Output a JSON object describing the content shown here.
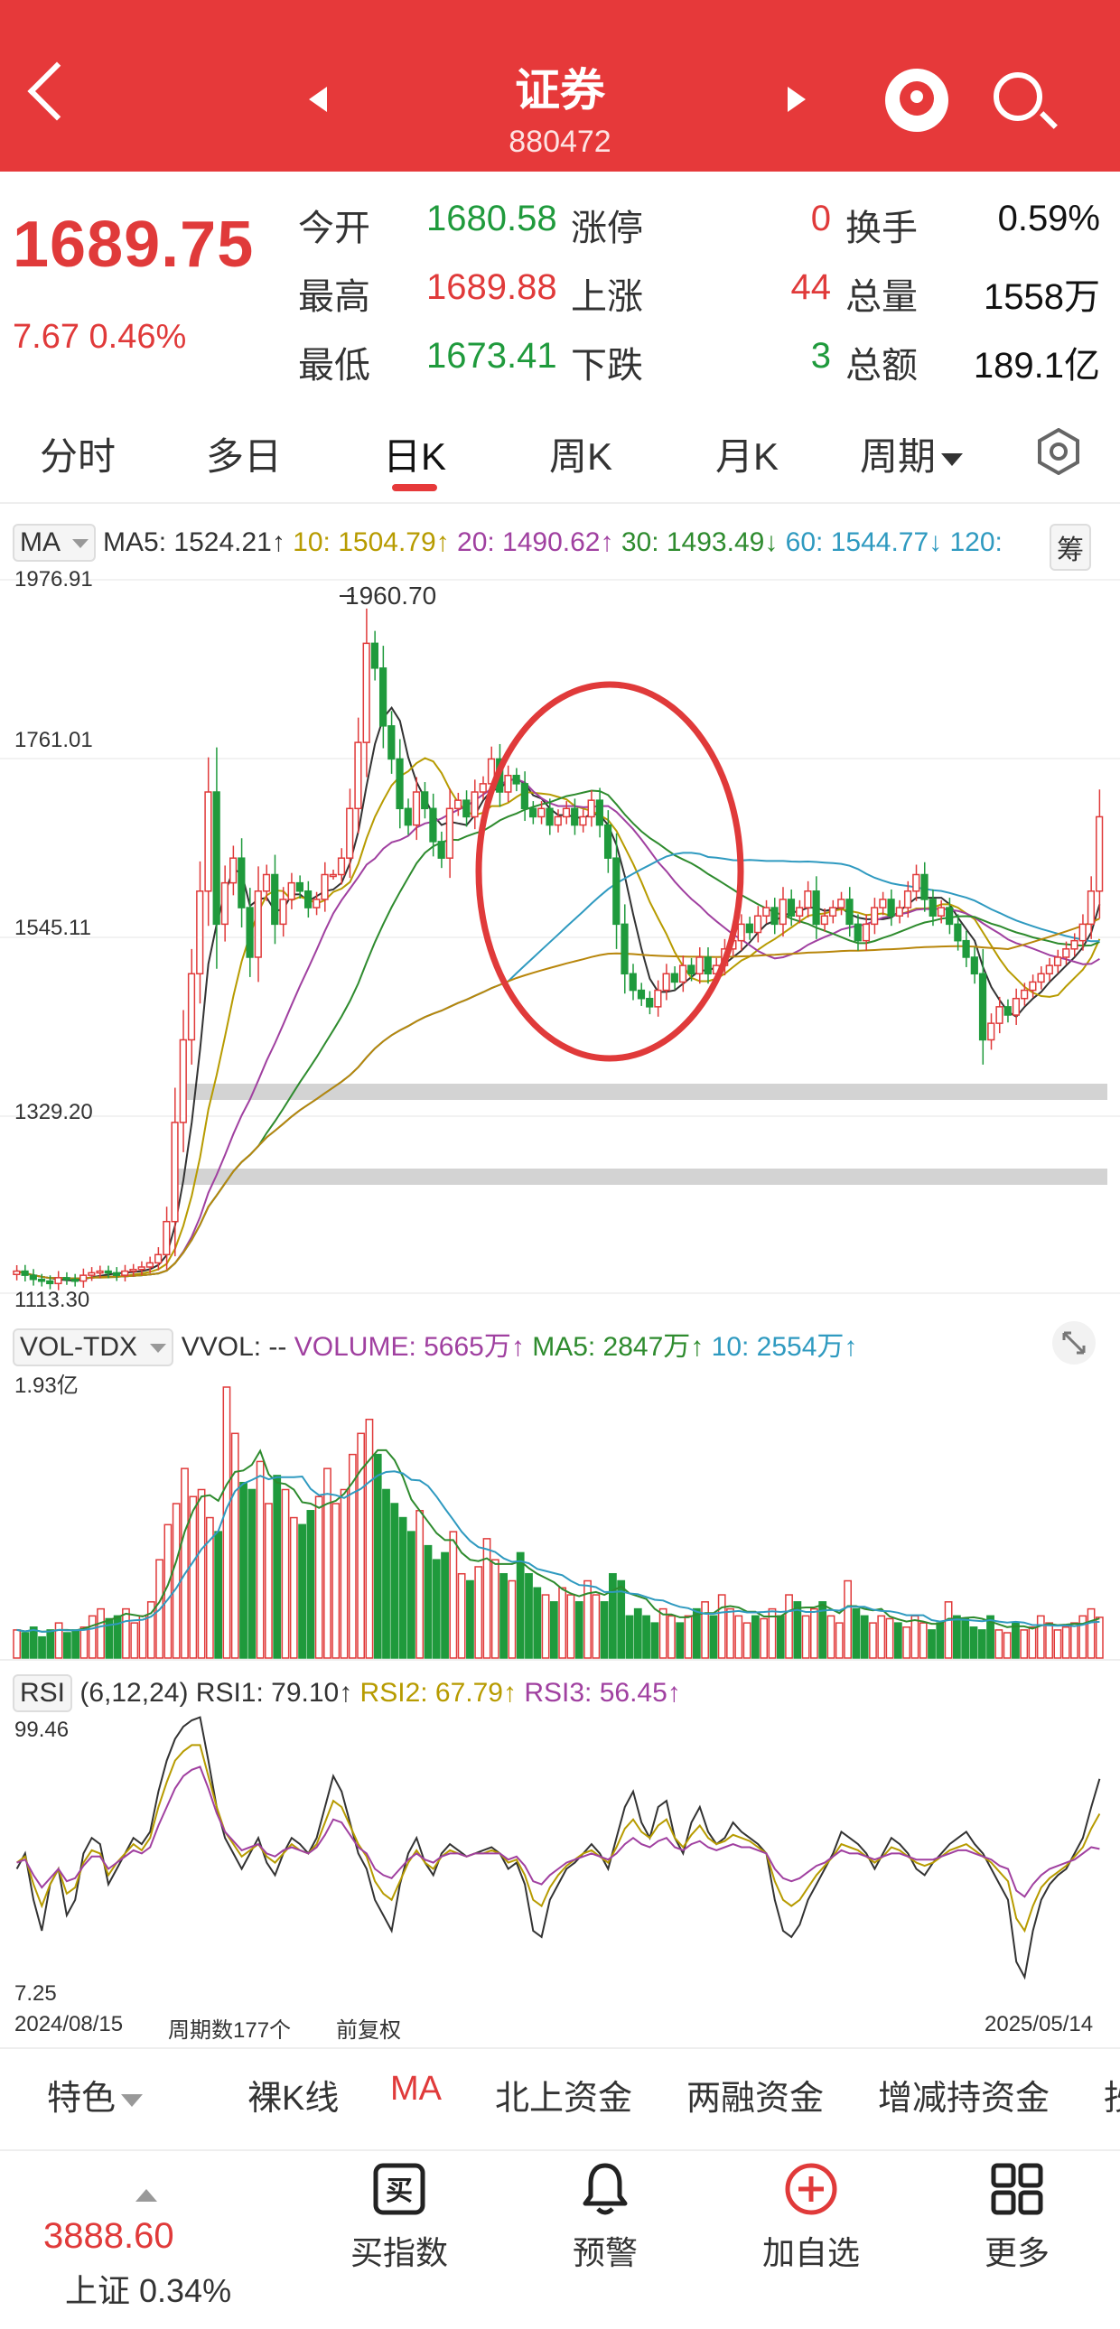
{
  "header": {
    "title": "证券",
    "code": "880472"
  },
  "quote": {
    "price": "1689.75",
    "change": "7.67 0.46%",
    "stats": [
      {
        "label": "今开",
        "value": "1680.58",
        "color": "#1f9a3c"
      },
      {
        "label": "涨停",
        "value": "0",
        "color": "#e03a3a"
      },
      {
        "label": "换手",
        "value": "0.59%",
        "color": "#111111"
      },
      {
        "label": "最高",
        "value": "1689.88",
        "color": "#e03a3a"
      },
      {
        "label": "上涨",
        "value": "44",
        "color": "#e03a3a"
      },
      {
        "label": "总量",
        "value": "1558万",
        "color": "#111111"
      },
      {
        "label": "最低",
        "value": "1673.41",
        "color": "#1f9a3c"
      },
      {
        "label": "下跌",
        "value": "3",
        "color": "#1f9a3c"
      },
      {
        "label": "总额",
        "value": "189.1亿",
        "color": "#111111"
      }
    ]
  },
  "tabs": [
    "分时",
    "多日",
    "日K",
    "周K",
    "月K",
    "周期"
  ],
  "active_tab": "日K",
  "ma_legend": {
    "name": "MA",
    "items": [
      {
        "text": "MA5: 1524.21↑",
        "color": "#333333"
      },
      {
        "text": "10: 1504.79↑",
        "color": "#b79b00"
      },
      {
        "text": "20: 1490.62↑",
        "color": "#a040a0"
      },
      {
        "text": "30: 1493.49↓",
        "color": "#2e8b2e"
      },
      {
        "text": "60: 1544.77↓",
        "color": "#2f9ac0"
      },
      {
        "text": "120:",
        "color": "#2f9ac0"
      }
    ],
    "extra": "筹"
  },
  "vol_legend": {
    "name": "VOL-TDX",
    "items": [
      {
        "text": "VVOL: --",
        "color": "#333333"
      },
      {
        "text": "VOLUME: 5665万↑",
        "color": "#a040a0"
      },
      {
        "text": "MA5: 2847万↑",
        "color": "#2e8b2e"
      },
      {
        "text": "10: 2554万↑",
        "color": "#2f9ac0"
      }
    ]
  },
  "rsi_legend": {
    "name": "RSI",
    "items": [
      {
        "text": "(6,12,24)",
        "color": "#333333"
      },
      {
        "text": "RSI1: 79.10↑",
        "color": "#333333"
      },
      {
        "text": "RSI2: 67.79↑",
        "color": "#b79b00"
      },
      {
        "text": "RSI3: 56.45↑",
        "color": "#a040a0"
      }
    ]
  },
  "footer": {
    "start": "2024/08/15",
    "periods": "周期数177个",
    "adjust": "前复权",
    "end": "2025/05/14"
  },
  "bottom_tabs": [
    "特色",
    "裸K线",
    "MA",
    "北上资金",
    "两融资金",
    "增减持资金",
    "抄"
  ],
  "bottom_active": "MA",
  "nav": {
    "index_value": "3888.60",
    "index_name": "上证 0.34%",
    "items": [
      "买指数",
      "预警",
      "加自选",
      "更多"
    ],
    "buy_icon_text": "买"
  },
  "colors": {
    "up": "#e03a3a",
    "down": "#1f9a3c",
    "accent": "#e6393a"
  },
  "chart_data": [
    {
      "type": "candlestick",
      "title": "",
      "y_ticks": [
        "1976.91",
        "1761.01",
        "1545.11",
        "1329.20",
        "1113.30"
      ],
      "ylim": [
        1113.3,
        1976.91
      ],
      "high_annotation": "1960.70",
      "close": [
        1140,
        1135,
        1130,
        1128,
        1125,
        1132,
        1130,
        1128,
        1135,
        1138,
        1140,
        1138,
        1135,
        1140,
        1142,
        1145,
        1150,
        1160,
        1200,
        1320,
        1420,
        1500,
        1600,
        1720,
        1560,
        1610,
        1640,
        1580,
        1520,
        1600,
        1620,
        1560,
        1590,
        1610,
        1600,
        1580,
        1590,
        1620,
        1620,
        1640,
        1700,
        1780,
        1900,
        1870,
        1800,
        1760,
        1700,
        1680,
        1720,
        1700,
        1660,
        1640,
        1700,
        1710,
        1690,
        1720,
        1730,
        1760,
        1720,
        1740,
        1730,
        1700,
        1690,
        1700,
        1680,
        1690,
        1700,
        1680,
        1690,
        1710,
        1680,
        1640,
        1560,
        1500,
        1480,
        1470,
        1460,
        1480,
        1500,
        1490,
        1510,
        1500,
        1520,
        1500,
        1510,
        1530,
        1540,
        1560,
        1550,
        1570,
        1580,
        1560,
        1590,
        1570,
        1580,
        1600,
        1560,
        1570,
        1580,
        1590,
        1560,
        1540,
        1560,
        1580,
        1590,
        1570,
        1580,
        1600,
        1620,
        1590,
        1570,
        1580,
        1560,
        1540,
        1520,
        1500,
        1420,
        1440,
        1460,
        1450,
        1470,
        1480,
        1490,
        1500,
        1510,
        1520,
        1530,
        1540,
        1560,
        1600,
        1690
      ],
      "series": [
        {
          "name": "MA5",
          "color": "#333333"
        },
        {
          "name": "10",
          "color": "#b79b00"
        },
        {
          "name": "20",
          "color": "#a040a0"
        },
        {
          "name": "30",
          "color": "#2e8b2e"
        },
        {
          "name": "60",
          "color": "#2f9ac0"
        },
        {
          "name": "120",
          "color": "#b8860b"
        }
      ]
    },
    {
      "type": "bar",
      "title": "",
      "y_top_label": "1.93亿",
      "values": [
        0.2,
        0.18,
        0.22,
        0.15,
        0.2,
        0.25,
        0.18,
        0.2,
        0.22,
        0.3,
        0.35,
        0.28,
        0.3,
        0.35,
        0.25,
        0.3,
        0.4,
        0.7,
        0.95,
        1.1,
        1.35,
        1.15,
        1.2,
        1.0,
        0.9,
        1.93,
        1.6,
        1.25,
        1.2,
        1.4,
        1.1,
        1.3,
        1.2,
        1.0,
        0.95,
        1.05,
        1.15,
        1.35,
        1.1,
        1.2,
        1.45,
        1.6,
        1.7,
        1.45,
        1.2,
        1.1,
        1.0,
        0.9,
        1.05,
        0.8,
        0.7,
        0.75,
        0.9,
        0.6,
        0.55,
        0.65,
        0.85,
        0.7,
        0.6,
        0.55,
        0.75,
        0.6,
        0.5,
        0.45,
        0.4,
        0.5,
        0.45,
        0.4,
        0.55,
        0.45,
        0.4,
        0.6,
        0.55,
        0.3,
        0.35,
        0.3,
        0.25,
        0.35,
        0.3,
        0.25,
        0.3,
        0.35,
        0.4,
        0.3,
        0.45,
        0.35,
        0.3,
        0.25,
        0.3,
        0.28,
        0.35,
        0.3,
        0.45,
        0.4,
        0.3,
        0.35,
        0.4,
        0.3,
        0.25,
        0.55,
        0.35,
        0.3,
        0.25,
        0.3,
        0.28,
        0.25,
        0.22,
        0.3,
        0.25,
        0.2,
        0.25,
        0.4,
        0.3,
        0.28,
        0.22,
        0.2,
        0.3,
        0.2,
        0.18,
        0.25,
        0.2,
        0.22,
        0.3,
        0.25,
        0.2,
        0.22,
        0.25,
        0.3,
        0.35,
        0.29
      ]
    },
    {
      "type": "line",
      "title": "",
      "y_ticks": [
        "99.46",
        "7.25"
      ],
      "ylim": [
        7.25,
        99.46
      ],
      "series": [
        {
          "name": "RSI1",
          "color": "#333333",
          "values": [
            50,
            55,
            40,
            30,
            45,
            50,
            35,
            40,
            55,
            60,
            58,
            45,
            50,
            55,
            60,
            58,
            62,
            75,
            85,
            92,
            96,
            98,
            99,
            85,
            70,
            60,
            55,
            50,
            55,
            60,
            52,
            48,
            55,
            60,
            58,
            55,
            60,
            70,
            80,
            75,
            65,
            55,
            50,
            40,
            35,
            30,
            45,
            55,
            60,
            52,
            48,
            55,
            58,
            56,
            54,
            55,
            56,
            57,
            55,
            50,
            52,
            45,
            30,
            28,
            40,
            45,
            50,
            52,
            55,
            58,
            55,
            50,
            60,
            70,
            75,
            65,
            60,
            70,
            72,
            60,
            55,
            65,
            70,
            62,
            58,
            60,
            65,
            62,
            60,
            58,
            55,
            40,
            30,
            28,
            32,
            40,
            45,
            50,
            55,
            62,
            60,
            58,
            55,
            50,
            55,
            60,
            58,
            55,
            50,
            48,
            52,
            55,
            58,
            60,
            62,
            58,
            55,
            50,
            45,
            40,
            20,
            15,
            30,
            40,
            45,
            48,
            50,
            55,
            60,
            70,
            79.1
          ]
        },
        {
          "name": "RSI2",
          "color": "#b79b00",
          "values": [
            52,
            54,
            45,
            38,
            45,
            50,
            42,
            44,
            52,
            56,
            55,
            48,
            52,
            55,
            58,
            56,
            60,
            70,
            78,
            85,
            88,
            90,
            90,
            80,
            70,
            62,
            58,
            54,
            56,
            58,
            54,
            52,
            55,
            58,
            56,
            55,
            58,
            65,
            72,
            70,
            64,
            58,
            54,
            46,
            42,
            40,
            46,
            52,
            56,
            52,
            50,
            54,
            56,
            55,
            54,
            55,
            55,
            56,
            55,
            52,
            53,
            48,
            40,
            38,
            44,
            48,
            51,
            53,
            55,
            56,
            54,
            52,
            57,
            63,
            66,
            62,
            60,
            64,
            66,
            60,
            57,
            61,
            64,
            60,
            58,
            59,
            61,
            60,
            59,
            57,
            55,
            46,
            40,
            38,
            40,
            44,
            48,
            51,
            54,
            58,
            57,
            56,
            54,
            52,
            54,
            57,
            56,
            54,
            52,
            51,
            52,
            54,
            56,
            57,
            58,
            56,
            54,
            52,
            49,
            46,
            34,
            30,
            38,
            44,
            47,
            49,
            51,
            54,
            57,
            63,
            67.79
          ]
        },
        {
          "name": "RSI3",
          "color": "#a040a0",
          "values": [
            52,
            53,
            48,
            44,
            47,
            50,
            46,
            47,
            51,
            54,
            54,
            50,
            52,
            54,
            56,
            55,
            57,
            64,
            70,
            76,
            80,
            82,
            83,
            76,
            68,
            62,
            59,
            56,
            57,
            58,
            55,
            54,
            56,
            57,
            56,
            55,
            57,
            61,
            66,
            65,
            61,
            57,
            55,
            50,
            48,
            47,
            50,
            53,
            55,
            53,
            52,
            54,
            55,
            55,
            54,
            55,
            55,
            55,
            55,
            53,
            54,
            51,
            46,
            45,
            48,
            50,
            52,
            53,
            54,
            55,
            54,
            53,
            55,
            58,
            60,
            58,
            57,
            59,
            60,
            57,
            56,
            58,
            59,
            57,
            56,
            57,
            58,
            57,
            57,
            56,
            55,
            50,
            47,
            46,
            47,
            49,
            51,
            52,
            54,
            56,
            55,
            55,
            54,
            53,
            54,
            55,
            55,
            54,
            53,
            53,
            53,
            54,
            55,
            56,
            56,
            55,
            54,
            53,
            51,
            50,
            43,
            41,
            45,
            48,
            50,
            51,
            52,
            53,
            55,
            57,
            56.45
          ]
        }
      ]
    }
  ]
}
